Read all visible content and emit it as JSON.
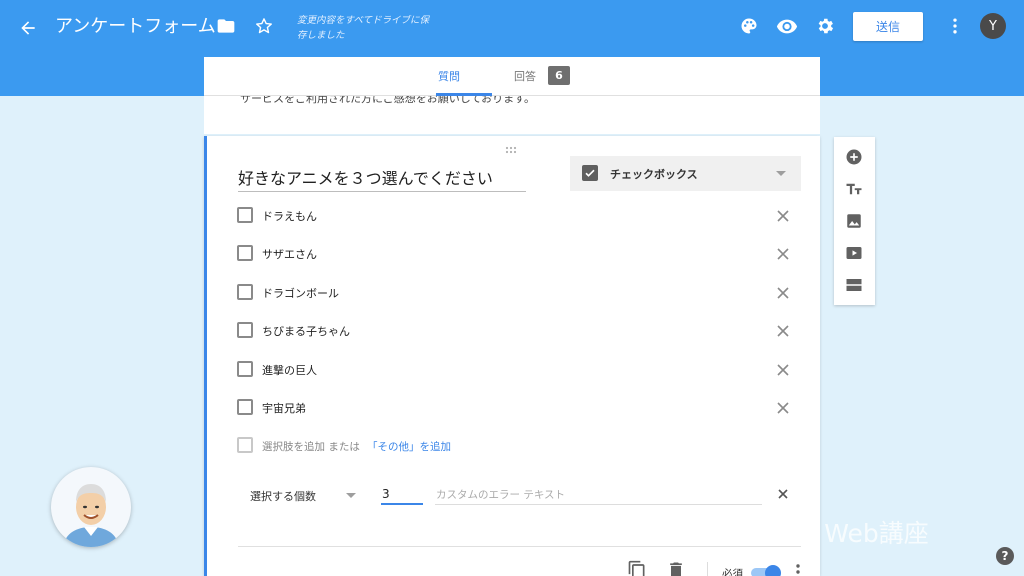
{
  "header": {
    "title": "アンケートフォーム",
    "saved_status": "変更内容をすべてドライブに保存しました",
    "send_label": "送信",
    "avatar_initial": "Y"
  },
  "tabs": {
    "questions_label": "質問",
    "responses_label": "回答",
    "responses_count": "6"
  },
  "previous_card": {
    "description": "サービスをご利用された方にご感想をお願いしております。"
  },
  "question": {
    "title": "好きなアニメを３つ選んでください",
    "type_label": "チェックボックス",
    "options": [
      "ドラえもん",
      "サザエさん",
      "ドラゴンボール",
      "ちびまる子ちゃん",
      "進撃の巨人",
      "宇宙兄弟"
    ],
    "add_option_label": "選択肢を追加",
    "or_label": "または",
    "add_other_label": "「その他」を追加",
    "validation": {
      "rule_label": "選択する個数",
      "number_value": "3",
      "error_placeholder": "カスタムのエラー テキスト"
    },
    "required_label": "必須"
  },
  "watermark": "ひとりWeb講座",
  "help_label": "?",
  "colors": {
    "header_bg": "#3b9af0",
    "accent": "#3b86e8",
    "page_bg": "#dff1fb"
  }
}
